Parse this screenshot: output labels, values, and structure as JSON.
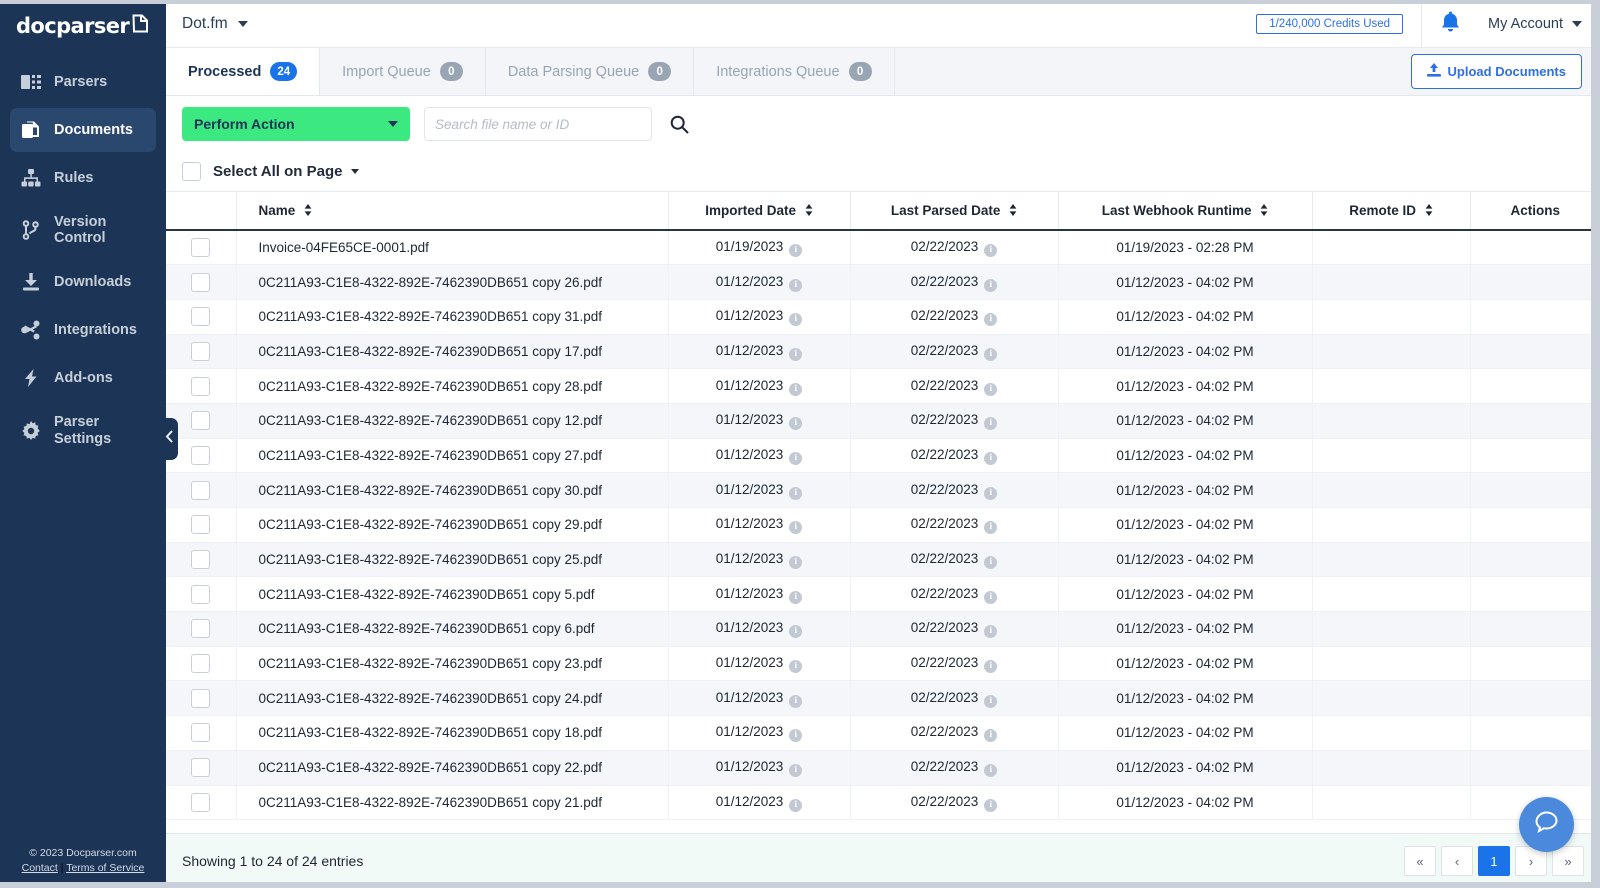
{
  "brand": {
    "name": "docparser",
    "mark_icon": "document-export-icon"
  },
  "sidebar": {
    "items": [
      {
        "label": "Parsers",
        "icon": "parsers-icon",
        "active": false
      },
      {
        "label": "Documents",
        "icon": "documents-icon",
        "active": true
      },
      {
        "label": "Rules",
        "icon": "rules-icon",
        "active": false
      },
      {
        "label": "Version Control",
        "icon": "version-control-icon",
        "active": false
      },
      {
        "label": "Downloads",
        "icon": "downloads-icon",
        "active": false
      },
      {
        "label": "Integrations",
        "icon": "integrations-icon",
        "active": false
      },
      {
        "label": "Add-ons",
        "icon": "addons-icon",
        "active": false
      },
      {
        "label": "Parser Settings",
        "icon": "gear-icon",
        "active": false
      }
    ],
    "footer": {
      "copyright": "© 2023 Docparser.com",
      "contact_label": "Contact",
      "separator": " | ",
      "terms_label": "Terms of Service"
    },
    "collapse_icon": "chevron-left-icon"
  },
  "topbar": {
    "project_name": "Dot.fm",
    "project_caret_icon": "chevron-down-icon",
    "credits_label": "1/240,000 Credits Used",
    "bell_icon": "bell-icon",
    "account_label": "My Account",
    "account_caret_icon": "chevron-down-icon"
  },
  "tabs": [
    {
      "label": "Processed",
      "count": "24",
      "active": true
    },
    {
      "label": "Import Queue",
      "count": "0",
      "active": false
    },
    {
      "label": "Data Parsing Queue",
      "count": "0",
      "active": false
    },
    {
      "label": "Integrations Queue",
      "count": "0",
      "active": false
    }
  ],
  "upload_button": {
    "label": "Upload Documents",
    "icon": "upload-icon"
  },
  "toolbar": {
    "perform_action_label": "Perform Action",
    "perform_action_caret_icon": "caret-down-icon",
    "search_placeholder": "Search file name or ID",
    "search_value": "",
    "search_icon": "search-icon"
  },
  "select_all": {
    "label": "Select All on Page",
    "caret_icon": "caret-down-icon",
    "checked": false
  },
  "table": {
    "columns": [
      {
        "key": "check",
        "label": "",
        "sortable": false
      },
      {
        "key": "name",
        "label": "Name",
        "sortable": true
      },
      {
        "key": "imported",
        "label": "Imported Date",
        "sortable": true
      },
      {
        "key": "parsed",
        "label": "Last Parsed Date",
        "sortable": true
      },
      {
        "key": "webhook",
        "label": "Last Webhook Runtime",
        "sortable": true
      },
      {
        "key": "remote",
        "label": "Remote ID",
        "sortable": true
      },
      {
        "key": "actions",
        "label": "Actions",
        "sortable": false
      }
    ],
    "rows": [
      {
        "name": "Invoice-04FE65CE-0001.pdf",
        "imported": "01/19/2023",
        "parsed": "02/22/2023",
        "webhook": "01/19/2023 - 02:28 PM",
        "remote": "",
        "actions": ""
      },
      {
        "name": "0C211A93-C1E8-4322-892E-7462390DB651 copy 26.pdf",
        "imported": "01/12/2023",
        "parsed": "02/22/2023",
        "webhook": "01/12/2023 - 04:02 PM",
        "remote": "",
        "actions": ""
      },
      {
        "name": "0C211A93-C1E8-4322-892E-7462390DB651 copy 31.pdf",
        "imported": "01/12/2023",
        "parsed": "02/22/2023",
        "webhook": "01/12/2023 - 04:02 PM",
        "remote": "",
        "actions": ""
      },
      {
        "name": "0C211A93-C1E8-4322-892E-7462390DB651 copy 17.pdf",
        "imported": "01/12/2023",
        "parsed": "02/22/2023",
        "webhook": "01/12/2023 - 04:02 PM",
        "remote": "",
        "actions": ""
      },
      {
        "name": "0C211A93-C1E8-4322-892E-7462390DB651 copy 28.pdf",
        "imported": "01/12/2023",
        "parsed": "02/22/2023",
        "webhook": "01/12/2023 - 04:02 PM",
        "remote": "",
        "actions": ""
      },
      {
        "name": "0C211A93-C1E8-4322-892E-7462390DB651 copy 12.pdf",
        "imported": "01/12/2023",
        "parsed": "02/22/2023",
        "webhook": "01/12/2023 - 04:02 PM",
        "remote": "",
        "actions": ""
      },
      {
        "name": "0C211A93-C1E8-4322-892E-7462390DB651 copy 27.pdf",
        "imported": "01/12/2023",
        "parsed": "02/22/2023",
        "webhook": "01/12/2023 - 04:02 PM",
        "remote": "",
        "actions": ""
      },
      {
        "name": "0C211A93-C1E8-4322-892E-7462390DB651 copy 30.pdf",
        "imported": "01/12/2023",
        "parsed": "02/22/2023",
        "webhook": "01/12/2023 - 04:02 PM",
        "remote": "",
        "actions": ""
      },
      {
        "name": "0C211A93-C1E8-4322-892E-7462390DB651 copy 29.pdf",
        "imported": "01/12/2023",
        "parsed": "02/22/2023",
        "webhook": "01/12/2023 - 04:02 PM",
        "remote": "",
        "actions": ""
      },
      {
        "name": "0C211A93-C1E8-4322-892E-7462390DB651 copy 25.pdf",
        "imported": "01/12/2023",
        "parsed": "02/22/2023",
        "webhook": "01/12/2023 - 04:02 PM",
        "remote": "",
        "actions": ""
      },
      {
        "name": "0C211A93-C1E8-4322-892E-7462390DB651 copy 5.pdf",
        "imported": "01/12/2023",
        "parsed": "02/22/2023",
        "webhook": "01/12/2023 - 04:02 PM",
        "remote": "",
        "actions": ""
      },
      {
        "name": "0C211A93-C1E8-4322-892E-7462390DB651 copy 6.pdf",
        "imported": "01/12/2023",
        "parsed": "02/22/2023",
        "webhook": "01/12/2023 - 04:02 PM",
        "remote": "",
        "actions": ""
      },
      {
        "name": "0C211A93-C1E8-4322-892E-7462390DB651 copy 23.pdf",
        "imported": "01/12/2023",
        "parsed": "02/22/2023",
        "webhook": "01/12/2023 - 04:02 PM",
        "remote": "",
        "actions": ""
      },
      {
        "name": "0C211A93-C1E8-4322-892E-7462390DB651 copy 24.pdf",
        "imported": "01/12/2023",
        "parsed": "02/22/2023",
        "webhook": "01/12/2023 - 04:02 PM",
        "remote": "",
        "actions": ""
      },
      {
        "name": "0C211A93-C1E8-4322-892E-7462390DB651 copy 18.pdf",
        "imported": "01/12/2023",
        "parsed": "02/22/2023",
        "webhook": "01/12/2023 - 04:02 PM",
        "remote": "",
        "actions": ""
      },
      {
        "name": "0C211A93-C1E8-4322-892E-7462390DB651 copy 22.pdf",
        "imported": "01/12/2023",
        "parsed": "02/22/2023",
        "webhook": "01/12/2023 - 04:02 PM",
        "remote": "",
        "actions": ""
      },
      {
        "name": "0C211A93-C1E8-4322-892E-7462390DB651 copy 21.pdf",
        "imported": "01/12/2023",
        "parsed": "02/22/2023",
        "webhook": "01/12/2023 - 04:02 PM",
        "remote": "",
        "actions": ""
      }
    ],
    "info_glyph": "i"
  },
  "footer": {
    "showing_text": "Showing 1 to 24 of 24 entries",
    "pagination": {
      "first_label": "«",
      "prev_label": "‹",
      "pages": [
        "1"
      ],
      "current_page": "1",
      "next_label": "›",
      "last_label": "»"
    }
  },
  "chat_widget": {
    "icon": "chat-bubble-icon"
  },
  "colors": {
    "sidebar_bg": "#1c3557",
    "accent_green": "#3ce880",
    "accent_blue": "#1a73e8",
    "link_blue": "#2f6fe4",
    "row_alt": "#f4f6fa",
    "footer_bg": "#f2faf7"
  }
}
